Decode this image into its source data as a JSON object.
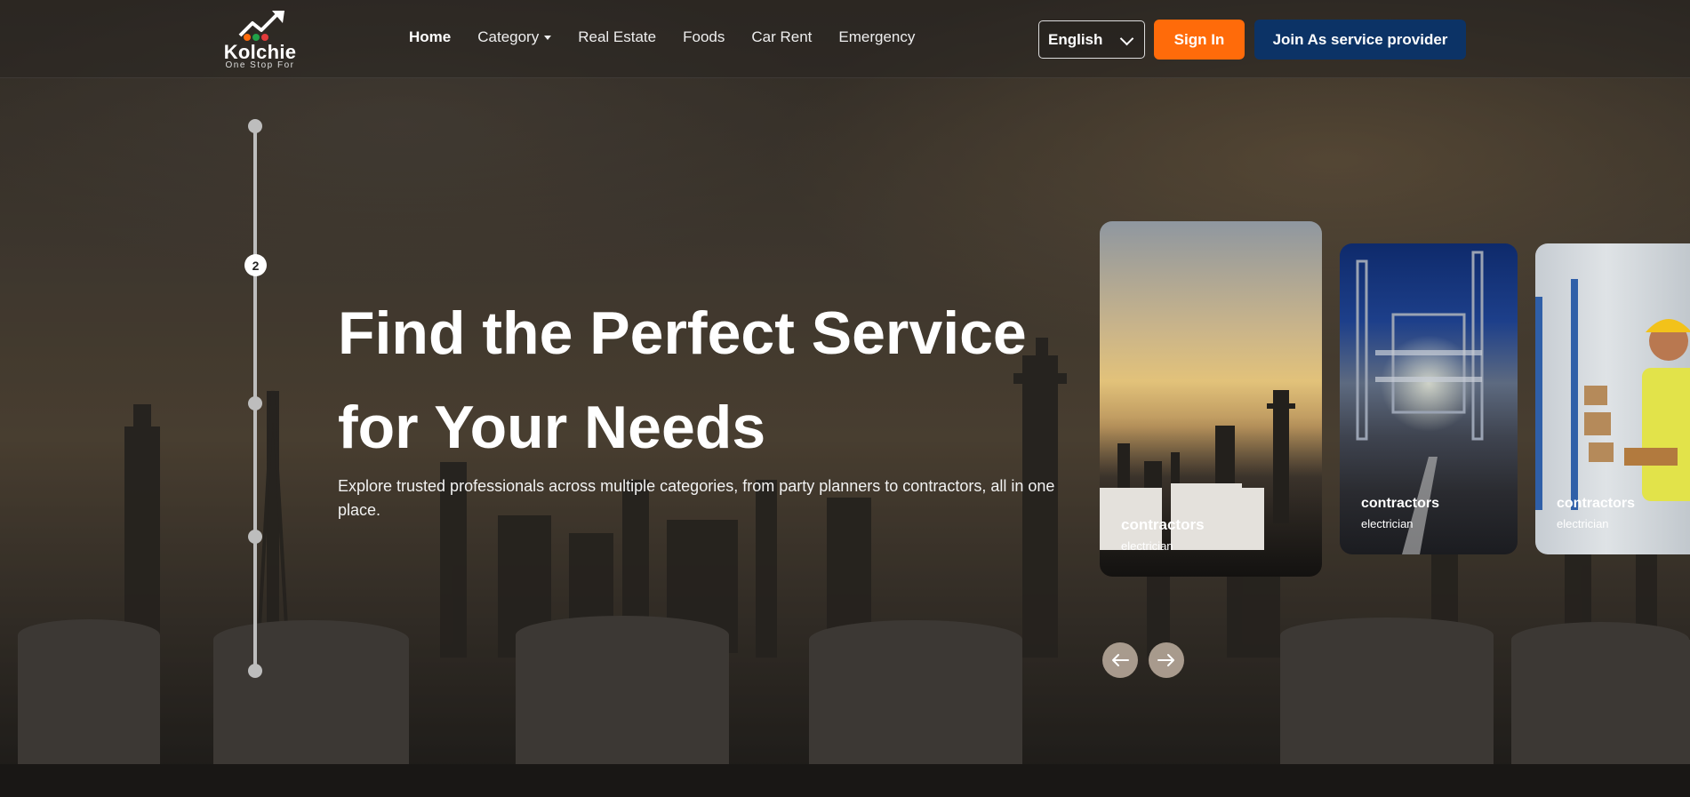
{
  "brand": {
    "name": "Kolchie",
    "tagline": "One Stop For",
    "colors": {
      "orange": "#ff6b0a",
      "navy": "#0c3366"
    }
  },
  "nav": {
    "items": [
      {
        "label": "Home",
        "active": true
      },
      {
        "label": "Category",
        "dropdown": true
      },
      {
        "label": "Real Estate"
      },
      {
        "label": "Foods"
      },
      {
        "label": "Car Rent"
      },
      {
        "label": "Emergency"
      }
    ]
  },
  "header": {
    "language": "English",
    "signin_label": "Sign In",
    "join_label": "Join As service provider"
  },
  "slider": {
    "active_index_label": "2"
  },
  "hero": {
    "title_line1": "Find the Perfect Service",
    "title_line2": "for Your Needs",
    "description": "Explore trusted professionals across multiple categories, from party planners to contractors, all in one place."
  },
  "cards": [
    {
      "title": "contractors",
      "subtitle": "electrician"
    },
    {
      "title": "contractors",
      "subtitle": "electrician"
    },
    {
      "title": "contractors",
      "subtitle": "electrician"
    }
  ],
  "icons": {
    "prev": "arrow-left-icon",
    "next": "arrow-right-icon",
    "lang": "chevron-down-icon"
  }
}
